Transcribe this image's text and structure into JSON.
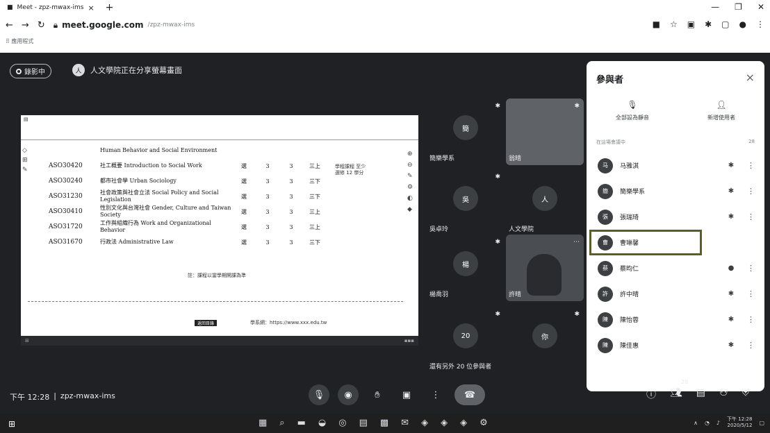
{
  "browser": {
    "tab_title": "Meet - zpz-mwax-ims",
    "new_tab": "+",
    "close_tab": "×",
    "window_controls": {
      "minimize": "—",
      "maximize": "❐",
      "close": "✕"
    },
    "url_host": "meet.google.com",
    "url_path": "/zpz-mwax-ims",
    "bookmarks_label": "應用程式"
  },
  "meet": {
    "recording_label": "錄影中",
    "presenting_text": "人文學院正在分享螢幕畫面",
    "shared_doc": {
      "rows": [
        {
          "code": "",
          "title": "Human Behavior and Social Environment",
          "c1": "",
          "c2": "",
          "c3": "",
          "c4": ""
        },
        {
          "code": "ASO30420",
          "title": "社工概要 Introduction to Social Work",
          "c1": "選",
          "c2": "3",
          "c3": "3",
          "c4": "三上"
        },
        {
          "code": "ASO30240",
          "title": "都市社會學 Urban Sociology",
          "c1": "選",
          "c2": "3",
          "c3": "3",
          "c4": "三下"
        },
        {
          "code": "ASO31230",
          "title": "社會政策與社會立法 Social Policy and Social Legislation",
          "c1": "選",
          "c2": "3",
          "c3": "3",
          "c4": "三下"
        },
        {
          "code": "ASO30410",
          "title": "性別文化與台灣社會 Gender, Culture and Taiwan Society",
          "c1": "選",
          "c2": "3",
          "c3": "3",
          "c4": "三上"
        },
        {
          "code": "ASO31720",
          "title": "工作與組織行為 Work and Organizational Behavior",
          "c1": "選",
          "c2": "3",
          "c3": "3",
          "c4": "三上"
        },
        {
          "code": "ASO31670",
          "title": "行政法 Administrative Law",
          "c1": "選",
          "c2": "3",
          "c3": "3",
          "c4": "三下"
        }
      ],
      "side_note": "學程課程 至少選修 12 學分",
      "note": "註：課程以當學期開課為準",
      "footer_button": "返回目錄",
      "footer_right": "學系網：https://www.xxx.edu.tw"
    },
    "tiles": [
      {
        "name": "簡樂學系",
        "initial": "簡"
      },
      {
        "name": "翁晴",
        "initial": ""
      },
      {
        "name": "吳卓玲",
        "initial": "吳"
      },
      {
        "name": "人文學院",
        "initial": "人"
      },
      {
        "name": "楊喬羽",
        "initial": "楊"
      },
      {
        "name": "許晴",
        "initial": ""
      },
      {
        "name": "還有另外 20 位參與者",
        "initial": "20"
      },
      {
        "name": "你",
        "initial": "你"
      }
    ],
    "panel": {
      "title": "參與者",
      "close": "×",
      "mute_all": "全部設為靜音",
      "add_people": "新增使用者",
      "sub_left": "在這場會議中",
      "sub_right": "28",
      "participants": [
        {
          "name": "马雅淇",
          "initial": "马"
        },
        {
          "name": "簡樂學系",
          "initial": "簡"
        },
        {
          "name": "張瑞琦",
          "initial": "張"
        },
        {
          "name": "曹琳馨",
          "initial": "曹"
        },
        {
          "name": "蔡昀仁",
          "initial": "蔡"
        },
        {
          "name": "許中晴",
          "initial": "許"
        },
        {
          "name": "陳怡蓉",
          "initial": "陳"
        },
        {
          "name": "陳佳惠",
          "initial": "陳"
        }
      ]
    },
    "bottom": {
      "time": "下午 12:28",
      "separator": "|",
      "meeting_code": "zpz-mwax-ims",
      "participant_count": "28"
    }
  },
  "taskbar": {
    "clock_time": "下午 12:28",
    "clock_date": "2020/5/12"
  }
}
